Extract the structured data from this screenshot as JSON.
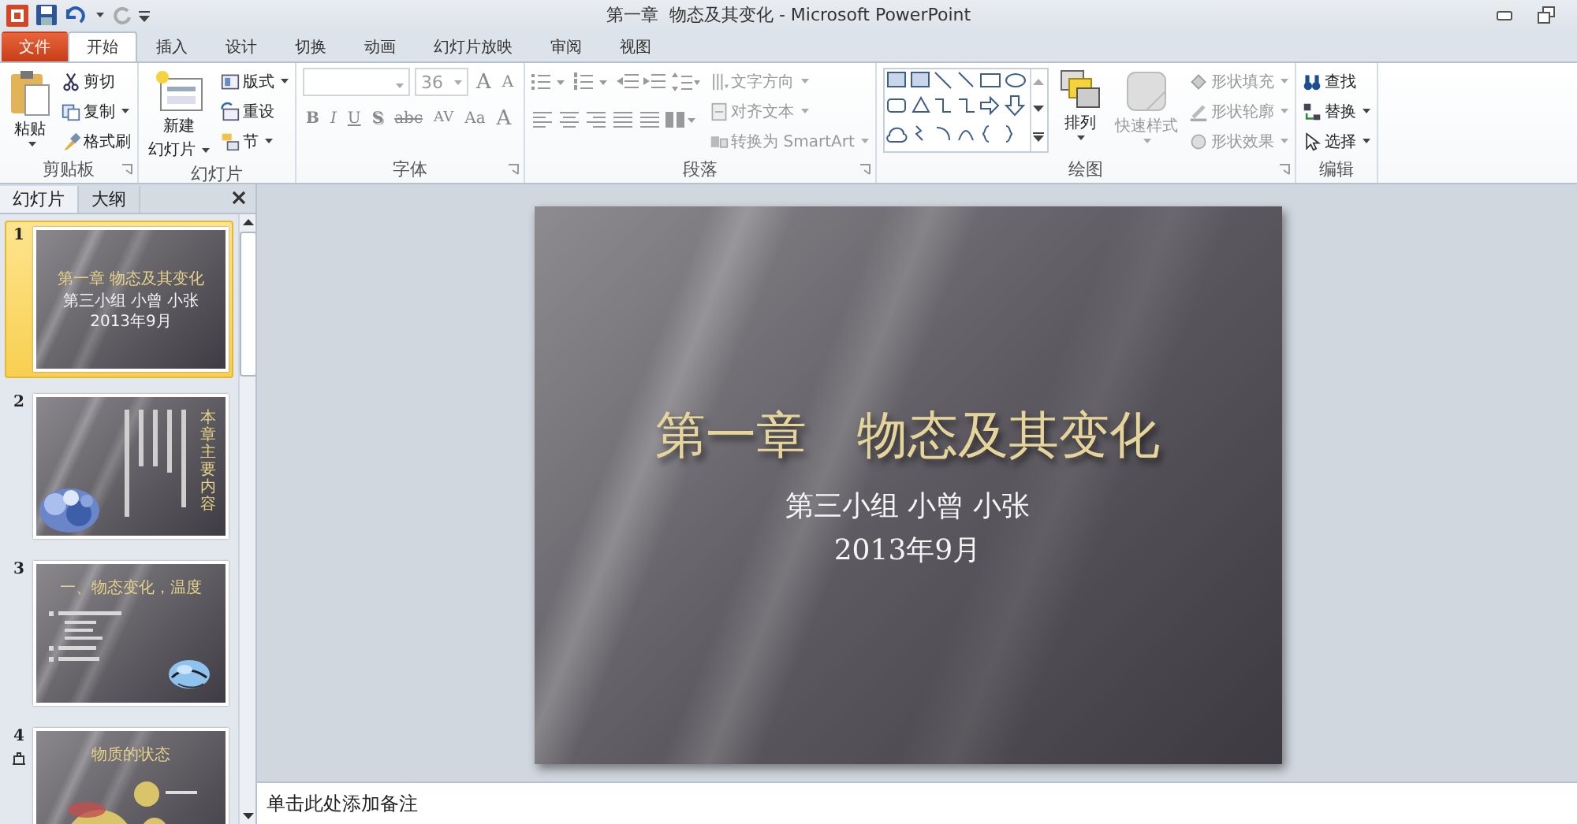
{
  "window": {
    "title": "第一章  物态及其变化 - Microsoft PowerPoint"
  },
  "tabs": [
    {
      "label": "文件",
      "kind": "file",
      "selected": false
    },
    {
      "label": "开始",
      "kind": "tab",
      "selected": true
    },
    {
      "label": "插入",
      "kind": "tab",
      "selected": false
    },
    {
      "label": "设计",
      "kind": "tab",
      "selected": false
    },
    {
      "label": "切换",
      "kind": "tab",
      "selected": false
    },
    {
      "label": "动画",
      "kind": "tab",
      "selected": false
    },
    {
      "label": "幻灯片放映",
      "kind": "tab",
      "selected": false
    },
    {
      "label": "审阅",
      "kind": "tab",
      "selected": false
    },
    {
      "label": "视图",
      "kind": "tab",
      "selected": false
    }
  ],
  "ribbon": {
    "clipboard": {
      "title": "剪贴板",
      "paste": {
        "label": "粘贴",
        "dropdown": true
      },
      "items": [
        {
          "label": "剪切",
          "dropdown": false
        },
        {
          "label": "复制",
          "dropdown": true
        },
        {
          "label": "格式刷",
          "dropdown": false
        }
      ]
    },
    "slides": {
      "title": "幻灯片",
      "new_slide": {
        "label": "新建",
        "label_2": "幻灯片",
        "dropdown": true
      },
      "items": [
        {
          "label": "版式",
          "dropdown": true
        },
        {
          "label": "重设",
          "dropdown": false
        },
        {
          "label": "节",
          "dropdown": true
        }
      ]
    },
    "font": {
      "title": "字体",
      "disabled": true,
      "font_size": "36",
      "size_buttons": [
        {
          "label": "A"
        },
        {
          "label": "A"
        }
      ],
      "buttons": [
        {
          "label": "B"
        },
        {
          "label": "I"
        },
        {
          "label": "U"
        },
        {
          "label": "S"
        },
        {
          "label": "abc"
        },
        {
          "label": "AV"
        },
        {
          "label": "Aa"
        },
        {
          "label": "A"
        }
      ]
    },
    "paragraph": {
      "title": "段落",
      "items": [
        {
          "label": "文字方向",
          "disabled": true,
          "dropdown": true
        },
        {
          "label": "对齐文本",
          "disabled": true,
          "dropdown": true
        },
        {
          "label": "转换为 SmartArt",
          "disabled": true,
          "dropdown": true
        }
      ]
    },
    "drawing": {
      "title": "绘图",
      "arrange": {
        "label": "排列",
        "disabled": false
      },
      "quick_styles": {
        "label": "快速样式",
        "disabled": true
      },
      "items": [
        {
          "label": "形状填充",
          "disabled": true
        },
        {
          "label": "形状轮廓",
          "disabled": true
        },
        {
          "label": "形状效果",
          "disabled": true
        }
      ]
    },
    "editing": {
      "title": "编辑",
      "items": [
        {
          "label": "查找",
          "dropdown": false
        },
        {
          "label": "替换",
          "dropdown": true
        },
        {
          "label": "选择",
          "dropdown": true
        }
      ]
    }
  },
  "slide_panel": {
    "tabs": [
      {
        "label": "幻灯片",
        "selected": true
      },
      {
        "label": "大纲",
        "selected": false
      }
    ],
    "slides": [
      {
        "number": "1",
        "selected": true,
        "kind": "title",
        "title": "第一章  物态及其变化",
        "lines": [
          "第三小组 小曾 小张",
          "2013年9月"
        ]
      },
      {
        "number": "2",
        "selected": false,
        "kind": "vertical",
        "title": "本章主要内容"
      },
      {
        "number": "3",
        "selected": false,
        "kind": "bullets",
        "title": "一、物态变化，温度"
      },
      {
        "number": "4",
        "selected": false,
        "kind": "diagram",
        "title": "物质的状态",
        "animated": true
      }
    ]
  },
  "slide": {
    "title": "第一章　物态及其变化",
    "subtitle": "第三小组 小曾 小张",
    "date": "2013年9月"
  },
  "notes": {
    "placeholder": "单击此处添加备注"
  }
}
